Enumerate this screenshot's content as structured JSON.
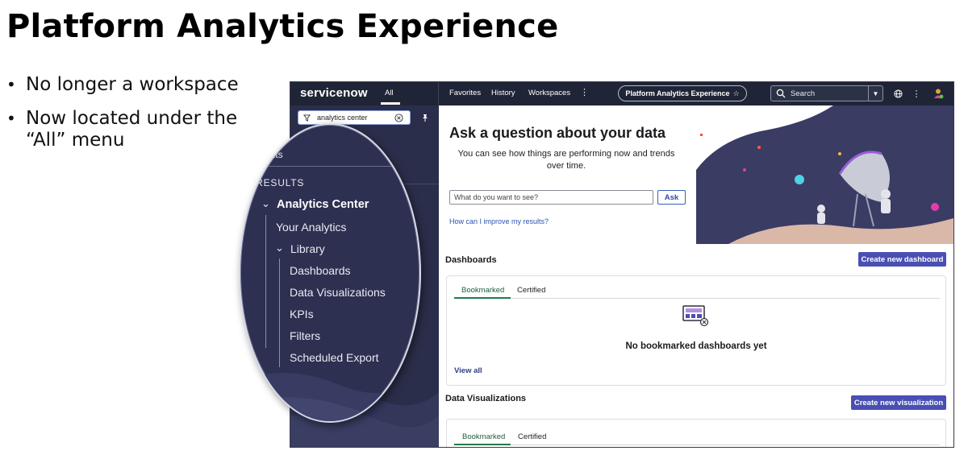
{
  "slide": {
    "title": "Platform Analytics Experience",
    "bullets": [
      "No longer a workspace",
      "Now located under the “All” menu"
    ]
  },
  "nav": {
    "logo": "servicenow",
    "all": "All",
    "links": [
      "Favorites",
      "History",
      "Workspaces"
    ],
    "more_icon": "more-vertical-icon",
    "pill_label": "Platform Analytics Experience",
    "pill_icon": "star-icon",
    "search_placeholder": "Search",
    "icons": [
      "globe-icon",
      "more-vertical-icon",
      "user-avatar-icon"
    ]
  },
  "sidebar": {
    "filter_value": "analytics center"
  },
  "magnifier": {
    "results_label": "sults",
    "all_results_label": "L RESULTS",
    "analytics_center": "Analytics Center",
    "your_analytics": "Your Analytics",
    "library": "Library",
    "items": [
      "Dashboards",
      "Data Visualizations",
      "KPIs",
      "Filters",
      "Scheduled Export"
    ]
  },
  "ask": {
    "title": "Ask a question about your data",
    "subtitle": "You can see how things are performing now and trends over time.",
    "input_placeholder": "What do you want to see?",
    "button": "Ask",
    "improve_link": "How can I improve my results?"
  },
  "dashboards": {
    "title": "Dashboards",
    "create_button": "Create new dashboard",
    "tabs": [
      "Bookmarked",
      "Certified"
    ],
    "empty_text": "No bookmarked dashboards yet",
    "view_all": "View all"
  },
  "visualizations": {
    "title": "Data Visualizations",
    "create_button": "Create new visualization",
    "tabs": [
      "Bookmarked",
      "Certified"
    ]
  },
  "colors": {
    "nav_bg": "#1f2536",
    "sidebar_bg": "#2b2e4a",
    "primary_button": "#4a4fb3",
    "active_tab": "#227a4a",
    "link": "#2a53b5"
  }
}
